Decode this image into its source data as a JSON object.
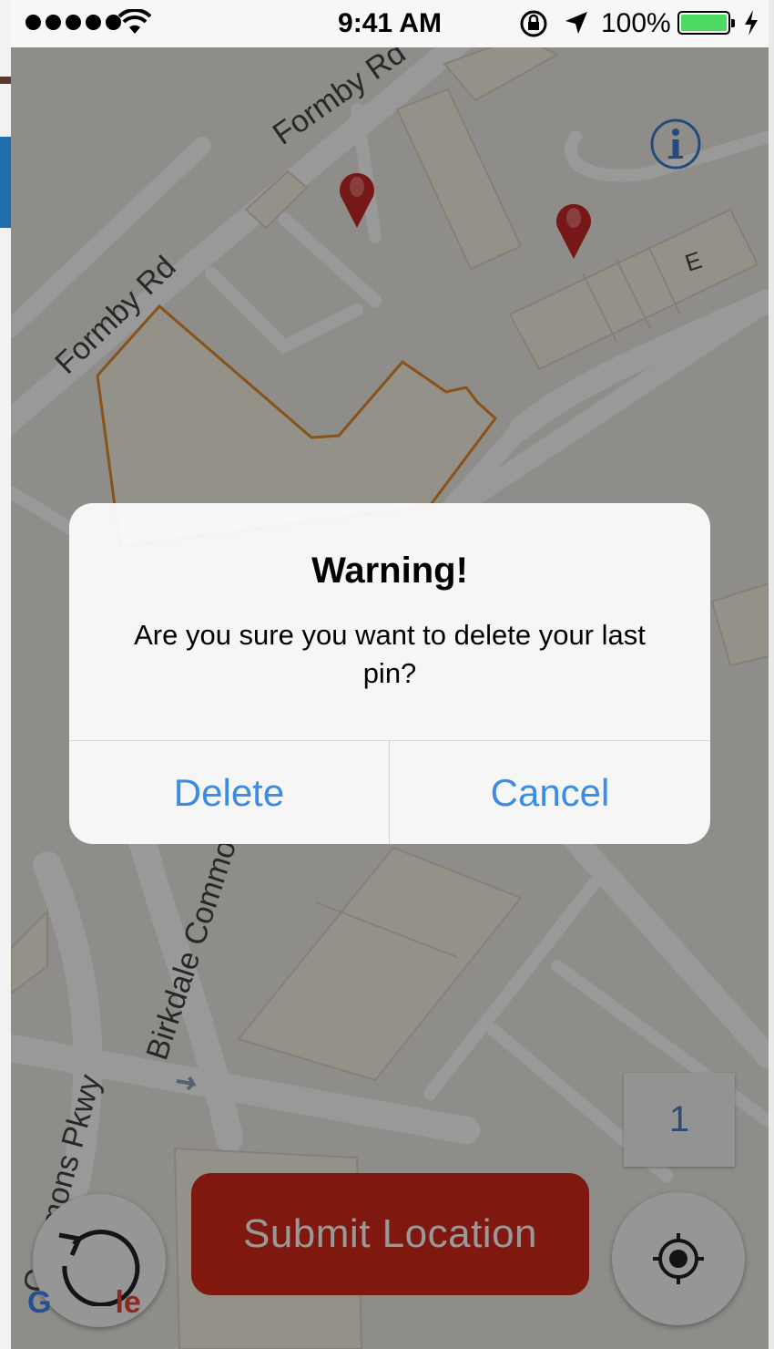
{
  "status_bar": {
    "time": "9:41 AM",
    "battery_percent": "100%",
    "icons": [
      "signal-dots-icon",
      "wifi-icon",
      "rotation-lock-icon",
      "location-arrow-icon",
      "battery-icon",
      "charging-bolt-icon"
    ],
    "battery_color": "#4cd964"
  },
  "map": {
    "street_labels": [
      "Formby Rd",
      "Formby Rd",
      "Birkdale Commo",
      "Commons Pkwy"
    ],
    "building_label": "E",
    "attribution": "Google",
    "pin_color": "#c62828",
    "pin_count_visible": 2
  },
  "controls": {
    "info_icon": "info-icon",
    "pin_counter": "1",
    "submit_label": "Submit Location",
    "submit_color": "#d42a1c",
    "undo_icon": "undo-icon",
    "locate_icon": "my-location-icon"
  },
  "alert": {
    "title": "Warning!",
    "message": "Are you sure you want to delete your last pin?",
    "buttons": [
      "Delete",
      "Cancel"
    ],
    "button_color": "#3b8ce4"
  }
}
